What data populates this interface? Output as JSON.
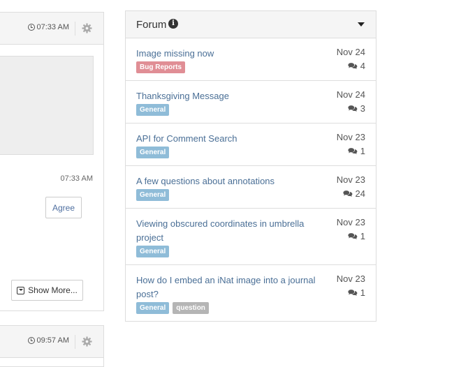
{
  "feed": {
    "card1": {
      "time": "07:33 AM",
      "reply_time": "07:33 AM",
      "agree_label": "Agree",
      "show_more_label": "Show More..."
    },
    "card2": {
      "time": "09:57 AM"
    }
  },
  "forum": {
    "title": "Forum",
    "topics": [
      {
        "title": "Image missing now",
        "date": "Nov 24",
        "comments": "4",
        "tags": [
          {
            "label": "Bug Reports",
            "color": "#e08e95"
          }
        ]
      },
      {
        "title": "Thanksgiving Message",
        "date": "Nov 24",
        "comments": "3",
        "tags": [
          {
            "label": "General",
            "color": "#8fbcd8"
          }
        ]
      },
      {
        "title": "API for Comment Search",
        "date": "Nov 23",
        "comments": "1",
        "tags": [
          {
            "label": "General",
            "color": "#8fbcd8"
          }
        ]
      },
      {
        "title": "A few questions about annotations",
        "date": "Nov 23",
        "comments": "24",
        "tags": [
          {
            "label": "General",
            "color": "#8fbcd8"
          }
        ]
      },
      {
        "title": "Viewing obscured coordinates in umbrella project",
        "date": "Nov 23",
        "comments": "1",
        "tags": [
          {
            "label": "General",
            "color": "#8fbcd8"
          }
        ]
      },
      {
        "title": "How do I embed an iNat image into a journal post?",
        "date": "Nov 23",
        "comments": "1",
        "tags": [
          {
            "label": "General",
            "color": "#8fbcd8"
          },
          {
            "label": "question",
            "color": "#b5b5b5"
          }
        ]
      }
    ]
  }
}
